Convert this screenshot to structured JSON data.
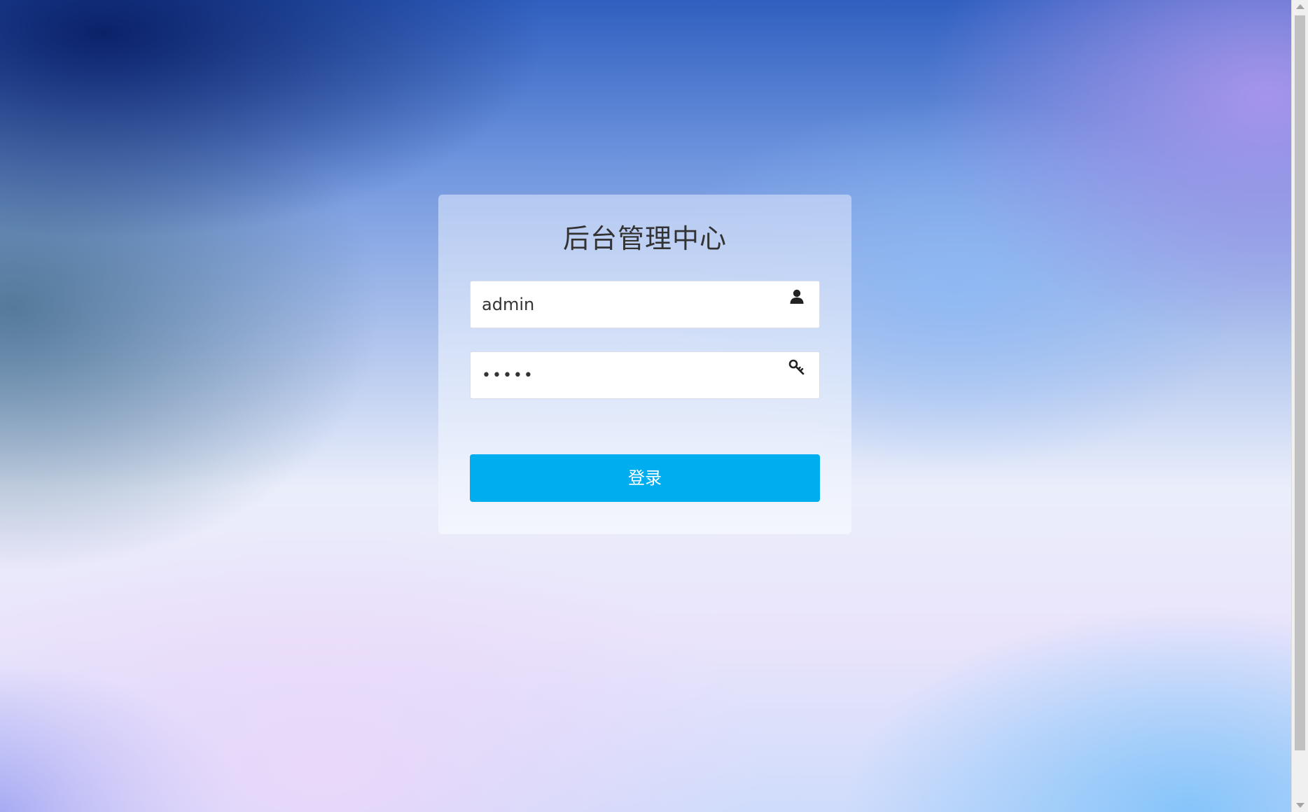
{
  "login": {
    "title": "后台管理中心",
    "username": {
      "value": "admin",
      "icon": "user-icon"
    },
    "password": {
      "value": "•••••",
      "icon": "key-icon"
    },
    "submit_label": "登录"
  },
  "colors": {
    "button": "#00aeef",
    "card_title": "#333333"
  }
}
